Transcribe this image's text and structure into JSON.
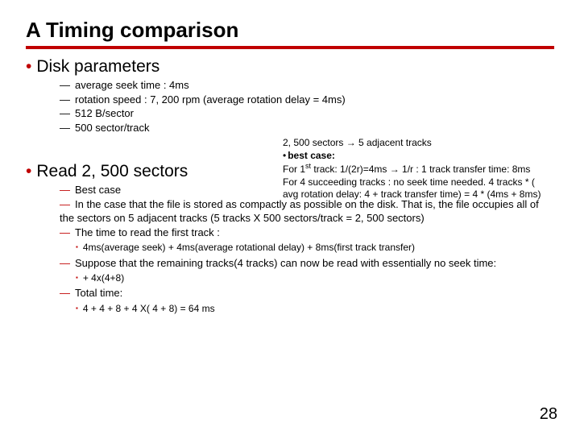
{
  "title": "A Timing comparison",
  "section1": {
    "heading": "Disk parameters",
    "items": [
      "average seek time : 4ms",
      "rotation speed : 7, 200 rpm (average rotation delay = 4ms)",
      "512 B/sector",
      "500 sector/track"
    ]
  },
  "callout": {
    "line1_a": "2, 500 sectors ",
    "line1_b": " 5 adjacent tracks",
    "line2": "best case:",
    "line3_a": "For 1",
    "line3_sup": "st",
    "line3_b": " track: 1/(2r)=4ms ",
    "line3_c": " 1/r :  1 track transfer time: 8ms",
    "line4": "For 4 succeeding tracks : no seek time needed. 4 tracks * ( avg rotation delay: 4 + track transfer time) = 4 * (4ms + 8ms)"
  },
  "section2": {
    "heading": "Read 2, 500 sectors",
    "items": {
      "i0": "Best case",
      "i1": "In the case that the file is stored as compactly as possible on the disk. That is, the file occupies all of the sectors on 5 adjacent tracks (5 tracks X 500 sectors/track = 2, 500 sectors)",
      "i2": "The time to read the first track :",
      "i2_sub": "4ms(average seek) + 4ms(average rotational delay) + 8ms(first track transfer)",
      "i3": "Suppose that the remaining tracks(4 tracks) can now be read with essentially no seek time:",
      "i3_sub": "+ 4x(4+8)",
      "i4": "Total time:",
      "i4_sub": "4 + 4 + 8 + 4 X( 4 + 8) = 64 ms"
    }
  },
  "arrow": "→",
  "page": "28"
}
